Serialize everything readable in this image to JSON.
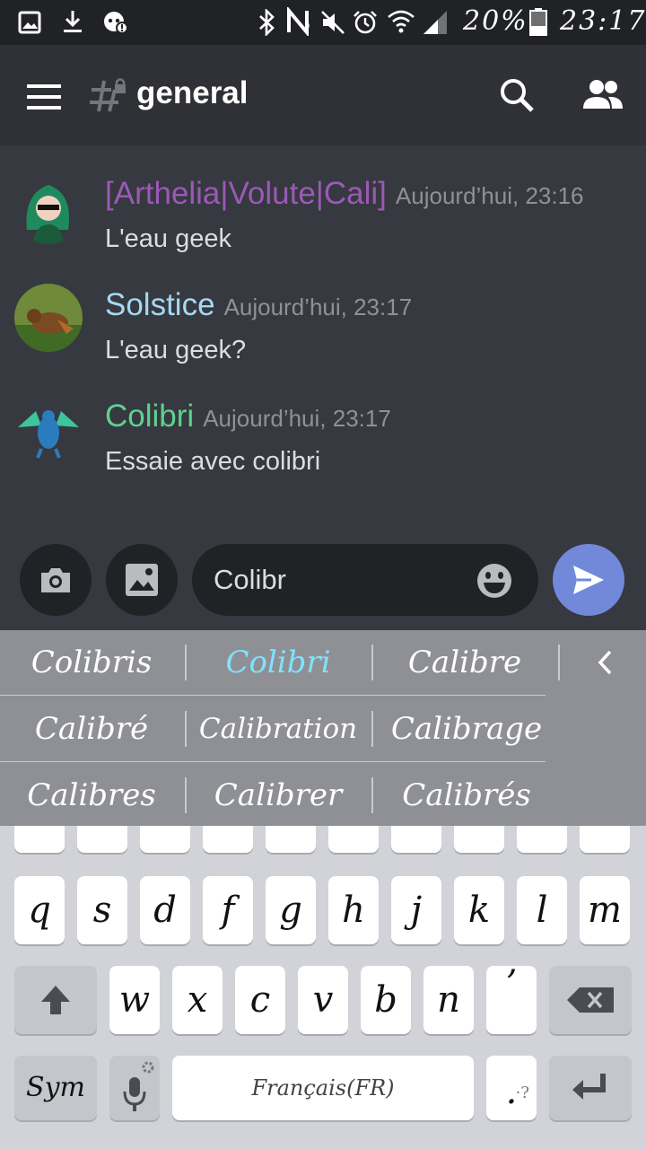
{
  "status_bar": {
    "battery": "20%",
    "time": "23:17"
  },
  "app_bar": {
    "channel_name": "general"
  },
  "messages": [
    {
      "author": "[Arthelia|Volute|Cali]",
      "author_color": "#9b59b6",
      "timestamp": "Aujourd’hui, 23:16",
      "text": "L'eau geek"
    },
    {
      "author": "Solstice",
      "author_color": "#a5d8f3",
      "timestamp": "Aujourd’hui, 23:17",
      "text": "L'eau geek?"
    },
    {
      "author": "Colibri",
      "author_color": "#5fd18e",
      "timestamp": "Aujourd’hui, 23:17",
      "text": "Essaie avec colibri"
    }
  ],
  "composer": {
    "value": "Colibr"
  },
  "suggestions": {
    "row1": [
      "Colibris",
      "Colibri",
      "Calibre"
    ],
    "row2": [
      "Calibré",
      "Calibration",
      "Calibrage"
    ],
    "row3": [
      "Calibres",
      "Calibrer",
      "Calibrés"
    ],
    "active": "Colibri"
  },
  "keyboard": {
    "row2": [
      "q",
      "s",
      "d",
      "f",
      "g",
      "h",
      "j",
      "k",
      "l",
      "m"
    ],
    "row3": [
      "w",
      "x",
      "c",
      "v",
      "b",
      "n",
      "’"
    ],
    "sym_label": "Sym",
    "space_label": "Français(FR)",
    "period_label": ".",
    "period_hint": "·?"
  },
  "colors": {
    "accent": "#7289da",
    "background": "#36393f",
    "app_bar": "#2f3136",
    "input_bg": "#202225"
  }
}
